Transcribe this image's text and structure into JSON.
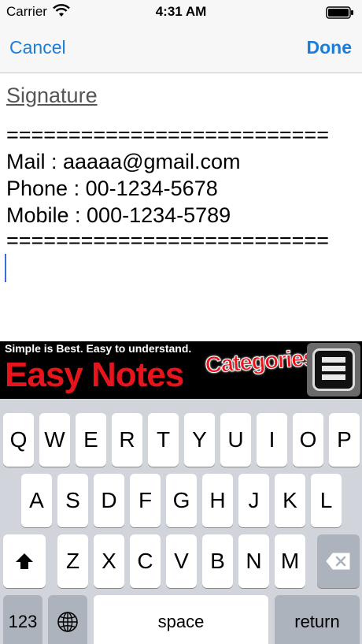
{
  "status_bar": {
    "carrier": "Carrier",
    "time": "4:31 AM",
    "icons": [
      "wifi-icon",
      "battery-icon"
    ]
  },
  "nav_bar": {
    "cancel_label": "Cancel",
    "done_label": "Done"
  },
  "editor": {
    "title": "Signature",
    "lines": [
      "==========================",
      "Mail : aaaaa@gmail.com",
      "Phone : 00-1234-5678",
      "Mobile : 000-1234-5789",
      "=========================="
    ]
  },
  "ad_banner": {
    "tagline": "Simple is Best. Easy to understand.",
    "brand": "Easy Notes",
    "categories": "Categories",
    "icon": "menu-list-icon"
  },
  "keyboard": {
    "row1": [
      "Q",
      "W",
      "E",
      "R",
      "T",
      "Y",
      "U",
      "I",
      "O",
      "P"
    ],
    "row2": [
      "A",
      "S",
      "D",
      "F",
      "G",
      "H",
      "J",
      "K",
      "L"
    ],
    "row3": [
      "Z",
      "X",
      "C",
      "V",
      "B",
      "N",
      "M"
    ],
    "numbers_label": "123",
    "space_label": "space",
    "return_label": "return",
    "icons": [
      "shift-icon",
      "backspace-icon",
      "globe-icon"
    ]
  },
  "colors": {
    "accent": "#1a7dd9",
    "brand_red": "#e8141b",
    "keyboard_bg": "#d1d5db"
  }
}
